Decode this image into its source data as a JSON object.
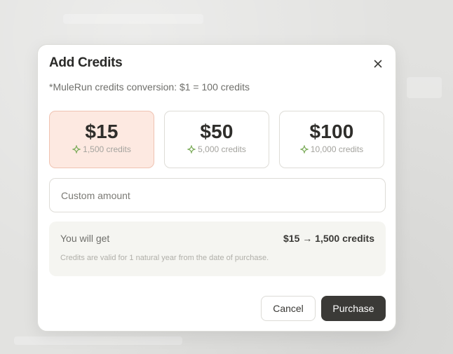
{
  "dialog": {
    "title": "Add Credits",
    "close_icon": "close-icon",
    "conversion_note": "*MuleRun credits conversion: $1 = 100 credits"
  },
  "tiers": [
    {
      "price": "$15",
      "credits": "1,500 credits",
      "selected": true
    },
    {
      "price": "$50",
      "credits": "5,000 credits",
      "selected": false
    },
    {
      "price": "$100",
      "credits": "10,000 credits",
      "selected": false
    }
  ],
  "credit_icon": "sparkle-icon",
  "custom_amount": {
    "placeholder": "Custom amount",
    "value": ""
  },
  "summary": {
    "label": "You will get",
    "value": "$15 → 1,500 credits",
    "note": "Credits are valid for 1 natural year from the date of purchase."
  },
  "actions": {
    "cancel_label": "Cancel",
    "purchase_label": "Purchase"
  },
  "colors": {
    "selected_tier_bg": "#fde9e1",
    "selected_tier_border": "#efc3b2",
    "sparkle_green": "#7fae5e",
    "primary_button": "#3b3a37"
  }
}
